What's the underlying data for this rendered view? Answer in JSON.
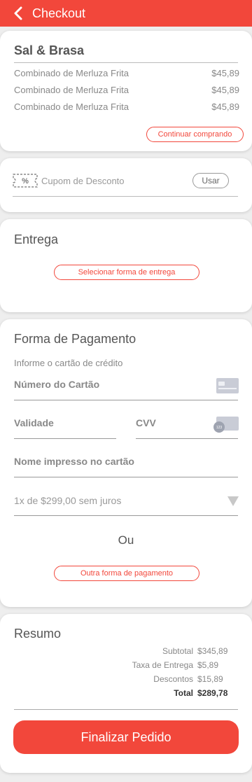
{
  "header": {
    "title": "Checkout"
  },
  "store": {
    "name": "Sal & Brasa",
    "items": [
      {
        "name": "Combinado de Merluza Frita",
        "price": "$45,89"
      },
      {
        "name": "Combinado de Merluza Frita",
        "price": "$45,89"
      },
      {
        "name": "Combinado de Merluza Frita",
        "price": "$45,89"
      }
    ],
    "continue_label": "Continuar comprando"
  },
  "coupon": {
    "label": "Cupom de Desconto",
    "use_label": "Usar",
    "icon": "percent-ticket-icon"
  },
  "delivery": {
    "title": "Entrega",
    "select_label": "Selecionar forma de entrega"
  },
  "payment": {
    "title": "Forma de Pagamento",
    "hint": "Informe o cartão de crédito",
    "card_number_label": "Número do Cartão",
    "validity_label": "Validade",
    "cvv_label": "CVV",
    "name_label": "Nome impresso no cartão",
    "installments": "1x de $299,00 sem juros",
    "or_label": "Ou",
    "other_label": "Outra forma de pagamento",
    "cvv_badge": "123"
  },
  "summary": {
    "title": "Resumo",
    "subtotal_label": "Subtotal",
    "subtotal_value": "$345,89",
    "delivery_fee_label": "Taxa de Entrega",
    "delivery_fee_value": "$5,89",
    "discounts_label": "Descontos",
    "discounts_value": "$15,89",
    "total_label": "Total",
    "total_value": "$289,78"
  },
  "finish_label": "Finalizar Pedido",
  "colors": {
    "accent": "#f2473b",
    "background": "#eeeeee"
  }
}
